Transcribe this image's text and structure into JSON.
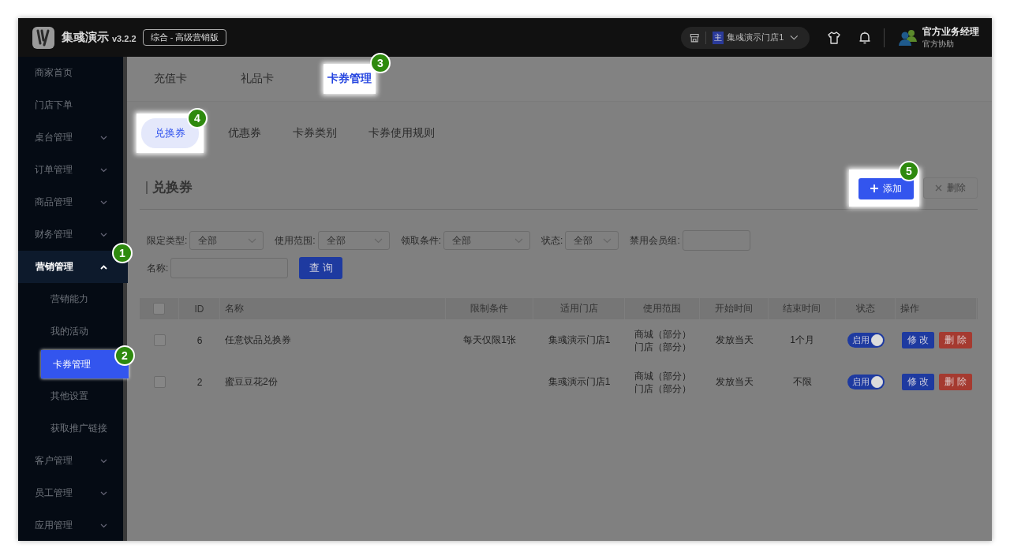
{
  "header": {
    "app_name": "集彧演示",
    "version": "v3.2.2",
    "edition": "综合 - 高级营销版",
    "store": {
      "badge": "主",
      "name": "集彧演示门店1"
    },
    "user": {
      "name": "官方业务经理",
      "role": "官方协助"
    }
  },
  "sidebar": {
    "items": [
      {
        "label": "商家首页",
        "kind": "link"
      },
      {
        "label": "门店下单",
        "kind": "link"
      },
      {
        "label": "桌台管理",
        "kind": "group",
        "expanded": false
      },
      {
        "label": "订单管理",
        "kind": "group",
        "expanded": false
      },
      {
        "label": "商品管理",
        "kind": "group",
        "expanded": false
      },
      {
        "label": "财务管理",
        "kind": "group",
        "expanded": false
      },
      {
        "label": "营销管理",
        "kind": "group",
        "expanded": true,
        "step": "1",
        "children": [
          {
            "label": "营销能力",
            "selected": false
          },
          {
            "label": "我的活动",
            "selected": false
          },
          {
            "label": "卡券管理",
            "selected": true,
            "step": "2"
          },
          {
            "label": "其他设置",
            "selected": false
          },
          {
            "label": "获取推广链接",
            "selected": false
          }
        ]
      },
      {
        "label": "客户管理",
        "kind": "group",
        "expanded": false
      },
      {
        "label": "员工管理",
        "kind": "group",
        "expanded": false
      },
      {
        "label": "应用管理",
        "kind": "group",
        "expanded": false
      }
    ]
  },
  "top_tabs": [
    {
      "label": "充值卡",
      "selected": false
    },
    {
      "label": "礼品卡",
      "selected": false
    },
    {
      "label": "卡券管理",
      "selected": true,
      "step": "3"
    }
  ],
  "sub_tabs": [
    {
      "label": "兑换券",
      "selected": true,
      "step": "4"
    },
    {
      "label": "优惠券",
      "selected": false
    },
    {
      "label": "卡券类别",
      "selected": false
    },
    {
      "label": "卡券使用规则",
      "selected": false
    }
  ],
  "section_title": "兑换券",
  "buttons": [
    {
      "label": "添加",
      "kind": "add",
      "disabled": false,
      "step": "5"
    },
    {
      "label": "删除",
      "kind": "delete",
      "disabled": true
    }
  ],
  "filters": [
    {
      "label": "限定类型:",
      "kind": "select",
      "value": "全部"
    },
    {
      "label": "使用范围:",
      "kind": "select",
      "value": "全部"
    },
    {
      "label": "领取条件:",
      "kind": "select",
      "value": "全部"
    },
    {
      "label": "状态:",
      "kind": "select",
      "value": "全部"
    },
    {
      "label": "禁用会员组:",
      "kind": "input"
    },
    {
      "label": "名称:",
      "kind": "input"
    }
  ],
  "search_button": "查 询",
  "table": {
    "header_checked": false,
    "columns": [
      "ID",
      "名称",
      "限制条件",
      "适用门店",
      "使用范围",
      "开始时间",
      "结束时间",
      "状态",
      "操作"
    ],
    "rows": [
      {
        "checked": false,
        "id": "6",
        "name": "任意饮品兑换券",
        "limit": "每天仅限1张",
        "store": "集彧演示门店1",
        "scope": [
          "商城（部分）",
          "门店（部分）"
        ],
        "start": "发放当天",
        "end": "1个月",
        "status": {
          "label": "启用",
          "on": true
        },
        "actions": [
          {
            "label": "修 改",
            "kind": "edit"
          },
          {
            "label": "删 除",
            "kind": "delete"
          }
        ]
      },
      {
        "checked": false,
        "id": "2",
        "name": "蜜豆豆花2份",
        "store": "集彧演示门店1",
        "scope": [
          "商城（部分）",
          "门店（部分）"
        ],
        "start": "发放当天",
        "end": "不限",
        "status": {
          "label": "启用",
          "on": true
        },
        "actions": [
          {
            "label": "修 改",
            "kind": "edit"
          },
          {
            "label": "删 除",
            "kind": "delete"
          }
        ]
      }
    ]
  }
}
